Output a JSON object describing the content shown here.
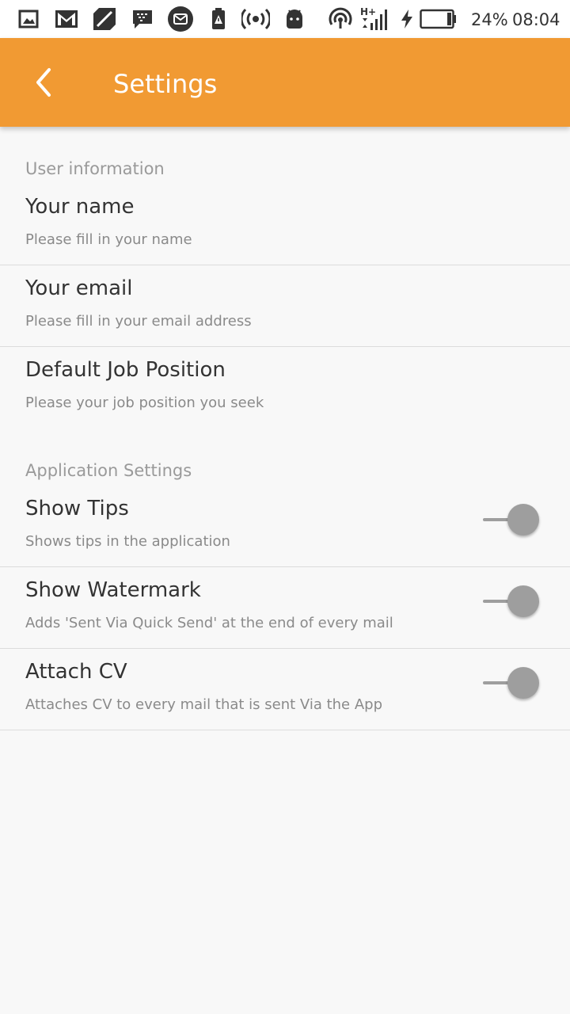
{
  "status_bar": {
    "battery_percent": "24%",
    "time": "08:04",
    "network": "H+",
    "icons": [
      "gallery-icon",
      "gmail-icon",
      "app-icon",
      "bbm-icon",
      "mail-icon",
      "alert-icon",
      "hotspot-icon",
      "android-icon",
      "wifi-icon",
      "signal-icon",
      "charging-icon",
      "battery-icon"
    ]
  },
  "toolbar": {
    "title": "Settings",
    "back_icon": "chevron-left-icon",
    "color": "#f19a33"
  },
  "sections": [
    {
      "header": "User information",
      "items": [
        {
          "title": "Your name",
          "summary": "Please fill in your name"
        },
        {
          "title": "Your email",
          "summary": "Please fill in your email address"
        },
        {
          "title": "Default Job Position",
          "summary": "Please your job position you seek"
        }
      ]
    },
    {
      "header": "Application Settings",
      "items": [
        {
          "title": "Show Tips",
          "summary": "Shows tips in the application",
          "switch_on": false
        },
        {
          "title": "Show Watermark",
          "summary": "Adds 'Sent Via Quick Send' at the end of every mail",
          "switch_on": false
        },
        {
          "title": "Attach CV",
          "summary": "Attaches CV to every mail that is sent Via the App",
          "switch_on": false
        }
      ]
    }
  ]
}
